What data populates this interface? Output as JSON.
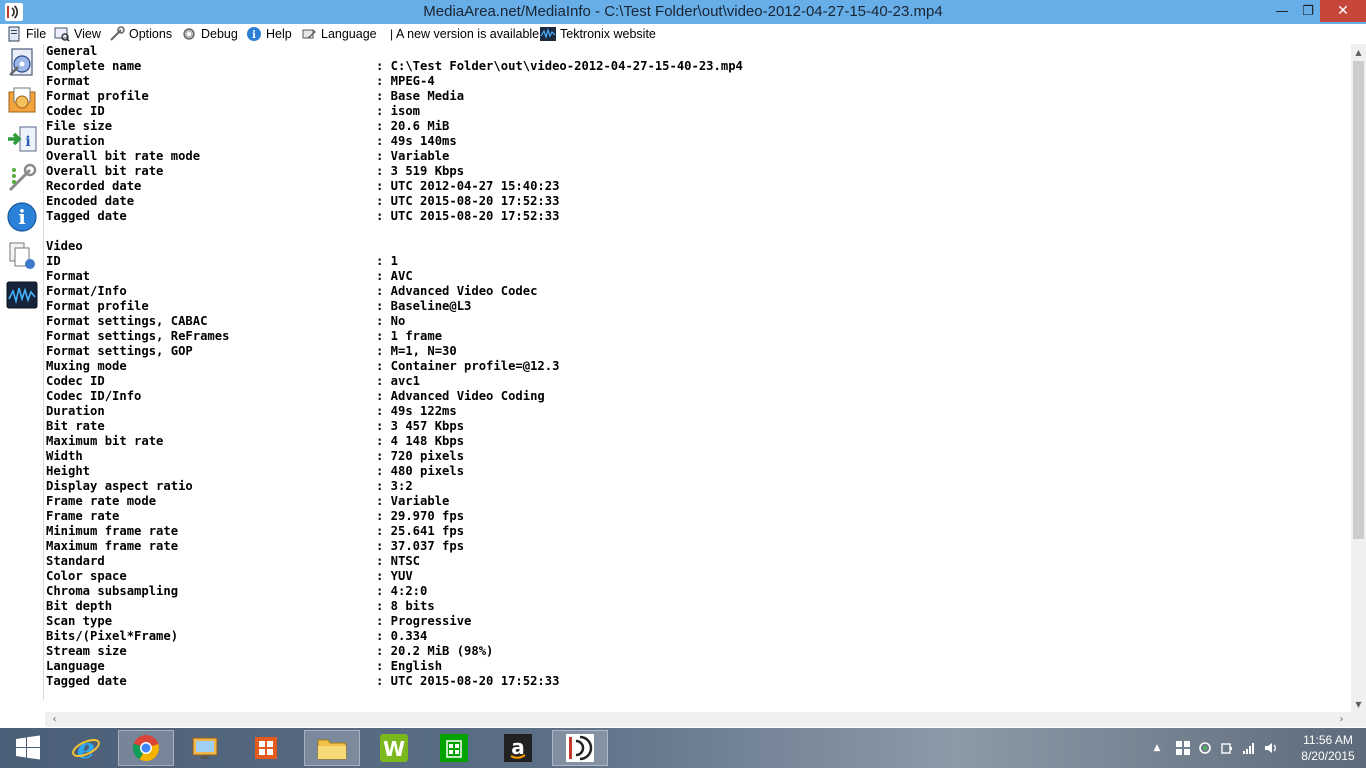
{
  "window": {
    "title": "MediaArea.net/MediaInfo - C:\\Test Folder\\out\\video-2012-04-27-15-40-23.mp4",
    "minimize_glyph": "—",
    "maximize_glyph": "❐",
    "close_glyph": "✕"
  },
  "menu": {
    "items": [
      {
        "label": "File",
        "icon": "file-icon"
      },
      {
        "label": "View",
        "icon": "view-icon"
      },
      {
        "label": "Options",
        "icon": "options-icon"
      },
      {
        "label": "Debug",
        "icon": "debug-icon"
      },
      {
        "label": "Help",
        "icon": "help-icon"
      },
      {
        "label": "Language",
        "icon": "language-icon"
      }
    ],
    "separator": "|",
    "new_version": "A new version is available",
    "tektronix": "Tektronix website"
  },
  "sidebar": {
    "buttons": [
      "open-file-icon",
      "open-folder-icon",
      "export-icon",
      "preferences-icon",
      "about-icon",
      "sheet-view-icon",
      "tektronix-icon"
    ]
  },
  "report": {
    "sections": [
      {
        "title": "General",
        "fields": [
          {
            "key": "Complete name",
            "value": "C:\\Test Folder\\out\\video-2012-04-27-15-40-23.mp4"
          },
          {
            "key": "Format",
            "value": "MPEG-4"
          },
          {
            "key": "Format profile",
            "value": "Base Media"
          },
          {
            "key": "Codec ID",
            "value": "isom"
          },
          {
            "key": "File size",
            "value": "20.6 MiB"
          },
          {
            "key": "Duration",
            "value": "49s 140ms"
          },
          {
            "key": "Overall bit rate mode",
            "value": "Variable"
          },
          {
            "key": "Overall bit rate",
            "value": "3 519 Kbps"
          },
          {
            "key": "Recorded date",
            "value": "UTC 2012-04-27 15:40:23"
          },
          {
            "key": "Encoded date",
            "value": "UTC 2015-08-20 17:52:33"
          },
          {
            "key": "Tagged date",
            "value": "UTC 2015-08-20 17:52:33"
          }
        ]
      },
      {
        "title": "Video",
        "fields": [
          {
            "key": "ID",
            "value": "1"
          },
          {
            "key": "Format",
            "value": "AVC"
          },
          {
            "key": "Format/Info",
            "value": "Advanced Video Codec"
          },
          {
            "key": "Format profile",
            "value": "Baseline@L3"
          },
          {
            "key": "Format settings, CABAC",
            "value": "No"
          },
          {
            "key": "Format settings, ReFrames",
            "value": "1 frame"
          },
          {
            "key": "Format settings, GOP",
            "value": "M=1, N=30"
          },
          {
            "key": "Muxing mode",
            "value": "Container profile=@12.3"
          },
          {
            "key": "Codec ID",
            "value": "avc1"
          },
          {
            "key": "Codec ID/Info",
            "value": "Advanced Video Coding"
          },
          {
            "key": "Duration",
            "value": "49s 122ms"
          },
          {
            "key": "Bit rate",
            "value": "3 457 Kbps"
          },
          {
            "key": "Maximum bit rate",
            "value": "4 148 Kbps"
          },
          {
            "key": "Width",
            "value": "720 pixels"
          },
          {
            "key": "Height",
            "value": "480 pixels"
          },
          {
            "key": "Display aspect ratio",
            "value": "3:2"
          },
          {
            "key": "Frame rate mode",
            "value": "Variable"
          },
          {
            "key": "Frame rate",
            "value": "29.970 fps"
          },
          {
            "key": "Minimum frame rate",
            "value": "25.641 fps"
          },
          {
            "key": "Maximum frame rate",
            "value": "37.037 fps"
          },
          {
            "key": "Standard",
            "value": "NTSC"
          },
          {
            "key": "Color space",
            "value": "YUV"
          },
          {
            "key": "Chroma subsampling",
            "value": "4:2:0"
          },
          {
            "key": "Bit depth",
            "value": "8 bits"
          },
          {
            "key": "Scan type",
            "value": "Progressive"
          },
          {
            "key": "Bits/(Pixel*Frame)",
            "value": "0.334"
          },
          {
            "key": "Stream size",
            "value": "20.2 MiB (98%)"
          },
          {
            "key": "Language",
            "value": "English"
          },
          {
            "key": "Tagged date",
            "value": "UTC 2015-08-20 17:52:33"
          }
        ]
      }
    ]
  },
  "taskbar": {
    "apps": [
      "start-icon",
      "internet-explorer-icon",
      "chrome-icon",
      "remote-desktop-icon",
      "office-icon",
      "file-explorer-icon",
      "word-perfect-icon",
      "store-icon",
      "amazon-icon",
      "mediainfo-icon"
    ],
    "active_app": "mediainfo-icon",
    "amazon_glyph": "a",
    "word_glyph": "W",
    "tray_overflow_glyph": "▲",
    "clock_time": "11:56 AM",
    "clock_date": "8/20/2015"
  },
  "colors": {
    "titlebar": "#67aee8",
    "close_button": "#c7463a",
    "text": "#000000"
  }
}
